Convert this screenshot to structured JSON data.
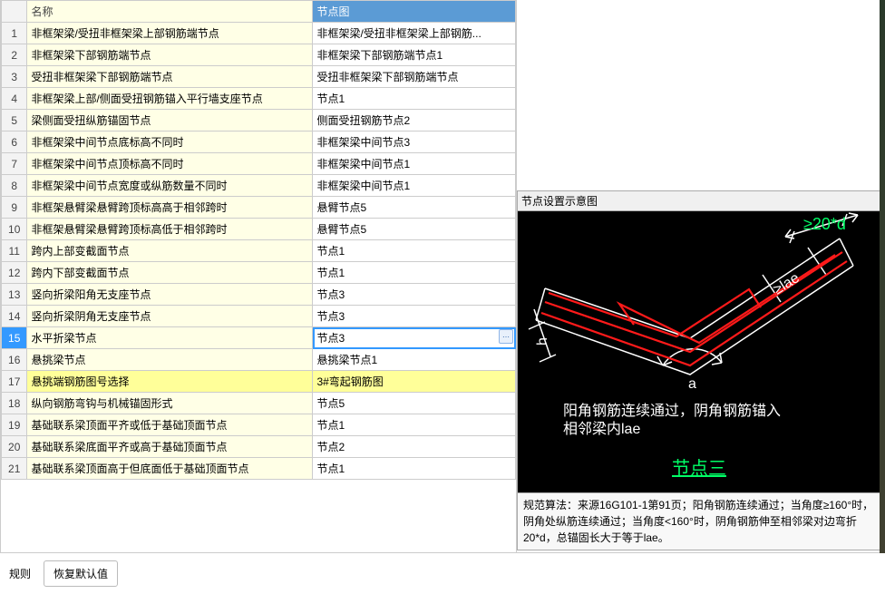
{
  "table": {
    "headers": {
      "name": "名称",
      "node": "节点图"
    },
    "rows": [
      {
        "num": 1,
        "name": "非框架梁/受扭非框架梁上部钢筋端节点",
        "node": "非框架梁/受扭非框架梁上部钢筋..."
      },
      {
        "num": 2,
        "name": "非框架梁下部钢筋端节点",
        "node": "非框架梁下部钢筋端节点1"
      },
      {
        "num": 3,
        "name": "受扭非框架梁下部钢筋端节点",
        "node": "受扭非框架梁下部钢筋端节点"
      },
      {
        "num": 4,
        "name": "非框架梁上部/侧面受扭钢筋锚入平行墙支座节点",
        "node": "节点1"
      },
      {
        "num": 5,
        "name": "梁侧面受扭纵筋锚固节点",
        "node": "侧面受扭钢筋节点2"
      },
      {
        "num": 6,
        "name": "非框架梁中间节点底标高不同时",
        "node": "非框架梁中间节点3"
      },
      {
        "num": 7,
        "name": "非框架梁中间节点顶标高不同时",
        "node": "非框架梁中间节点1"
      },
      {
        "num": 8,
        "name": "非框架梁中间节点宽度或纵筋数量不同时",
        "node": "非框架梁中间节点1"
      },
      {
        "num": 9,
        "name": "非框架悬臂梁悬臂跨顶标高高于相邻跨时",
        "node": "悬臂节点5"
      },
      {
        "num": 10,
        "name": "非框架悬臂梁悬臂跨顶标高低于相邻跨时",
        "node": "悬臂节点5"
      },
      {
        "num": 11,
        "name": "跨内上部变截面节点",
        "node": "节点1"
      },
      {
        "num": 12,
        "name": "跨内下部变截面节点",
        "node": "节点1"
      },
      {
        "num": 13,
        "name": "竖向折梁阳角无支座节点",
        "node": "节点3"
      },
      {
        "num": 14,
        "name": "竖向折梁阴角无支座节点",
        "node": "节点3"
      },
      {
        "num": 15,
        "name": "水平折梁节点",
        "node": "节点3",
        "selected": true
      },
      {
        "num": 16,
        "name": "悬挑梁节点",
        "node": "悬挑梁节点1"
      },
      {
        "num": 17,
        "name": "悬挑端钢筋图号选择",
        "node": "3#弯起钢筋图",
        "highlight": true
      },
      {
        "num": 18,
        "name": "纵向钢筋弯钩与机械锚固形式",
        "node": "节点5"
      },
      {
        "num": 19,
        "name": "基础联系梁顶面平齐或低于基础顶面节点",
        "node": "节点1"
      },
      {
        "num": 20,
        "name": "基础联系梁底面平齐或高于基础顶面节点",
        "node": "节点2"
      },
      {
        "num": 21,
        "name": "基础联系梁顶面高于但底面低于基础顶面节点",
        "node": "节点1"
      }
    ]
  },
  "previewTitle": "节点设置示意图",
  "diagram": {
    "annot20d": "≥20*d",
    "annotLae": "≥lae",
    "annotA": "a",
    "annotH": "h",
    "desc1": "阳角钢筋连续通过，阴角钢筋锚入",
    "desc2": "相邻梁内lae",
    "caption": "节点三"
  },
  "note": "规范算法：来源16G101-1第91页；阳角钢筋连续通过；当角度≥160°时，阴角处纵筋连续通过；当角度<160°时，阴角钢筋伸至相邻梁对边弯折20*d，总锚固长大于等于lae。",
  "buttons": {
    "rule": "规则",
    "restore": "恢复默认值"
  }
}
